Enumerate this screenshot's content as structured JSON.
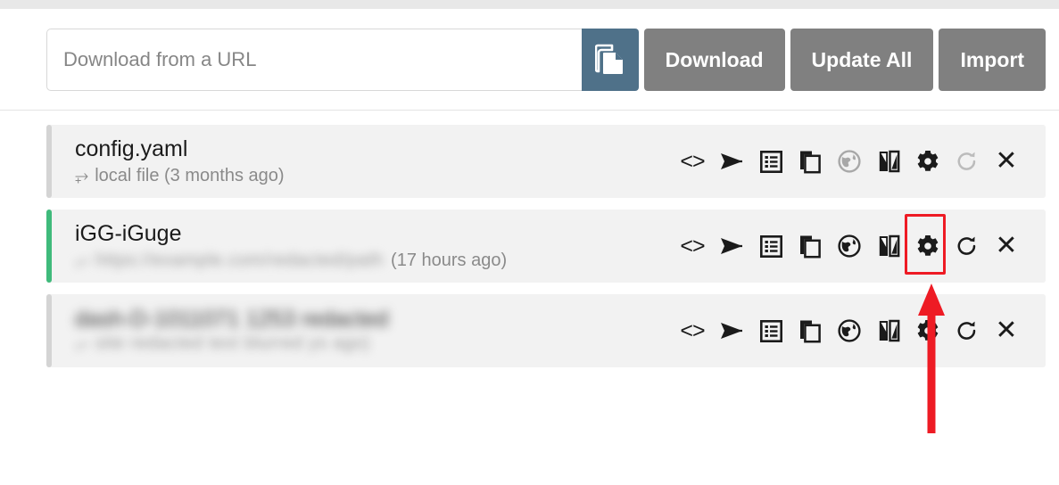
{
  "header": {
    "url_input": {
      "placeholder": "Download from a URL",
      "value": ""
    },
    "paste_button": {
      "icon": "copy-documents-icon",
      "label": "",
      "color": "#4f7189"
    },
    "buttons": [
      {
        "label": "Download",
        "color": "#808080"
      },
      {
        "label": "Update All",
        "color": "#808080"
      },
      {
        "label": "Import",
        "color": "#808080"
      }
    ]
  },
  "rows": [
    {
      "title": "config.yaml",
      "subtitle_prefix_icon": "hook-arrow-icon",
      "subtitle": "local file (3 months ago)",
      "subtitle_redacted": "",
      "subtitle_suffix": "",
      "accent_color": "#d4d4d4",
      "accent_state": "inactive",
      "redacted": false,
      "globe_enabled": false,
      "refresh_enabled": false,
      "gear_highlighted": false
    },
    {
      "title": "iGG-iGuge",
      "subtitle_prefix_icon": "hook-arrow-icon",
      "subtitle": "",
      "subtitle_redacted": "https://example.com/redacted/path",
      "subtitle_suffix": "(17 hours ago)",
      "accent_color": "#3fba7b",
      "accent_state": "active",
      "redacted": false,
      "globe_enabled": true,
      "refresh_enabled": true,
      "gear_highlighted": true
    },
    {
      "title": "",
      "title_redacted": "dash-D-1011071 1253 redacted",
      "subtitle_prefix_icon": "hook-arrow-icon",
      "subtitle": "",
      "subtitle_redacted": "site redacted text blurred",
      "subtitle_suffix": "ys ago)",
      "accent_color": "#d4d4d4",
      "accent_state": "inactive",
      "redacted": true,
      "globe_enabled": true,
      "refresh_enabled": true,
      "gear_highlighted": false
    }
  ],
  "row_actions": [
    {
      "name": "code-icon",
      "glyph": "<>"
    },
    {
      "name": "send-icon",
      "glyph": "send"
    },
    {
      "name": "list-icon",
      "glyph": "list"
    },
    {
      "name": "copy-icon",
      "glyph": "copy"
    },
    {
      "name": "globe-icon",
      "glyph": "globe"
    },
    {
      "name": "book-split-icon",
      "glyph": "book"
    },
    {
      "name": "gear-icon",
      "glyph": "gear"
    },
    {
      "name": "refresh-icon",
      "glyph": "refresh"
    },
    {
      "name": "close-icon",
      "glyph": "x"
    }
  ],
  "annotation": {
    "highlight_color": "#ee1b24",
    "arrow_color": "#ee1b24",
    "target": "gear-icon of row iGG-iGuge"
  }
}
